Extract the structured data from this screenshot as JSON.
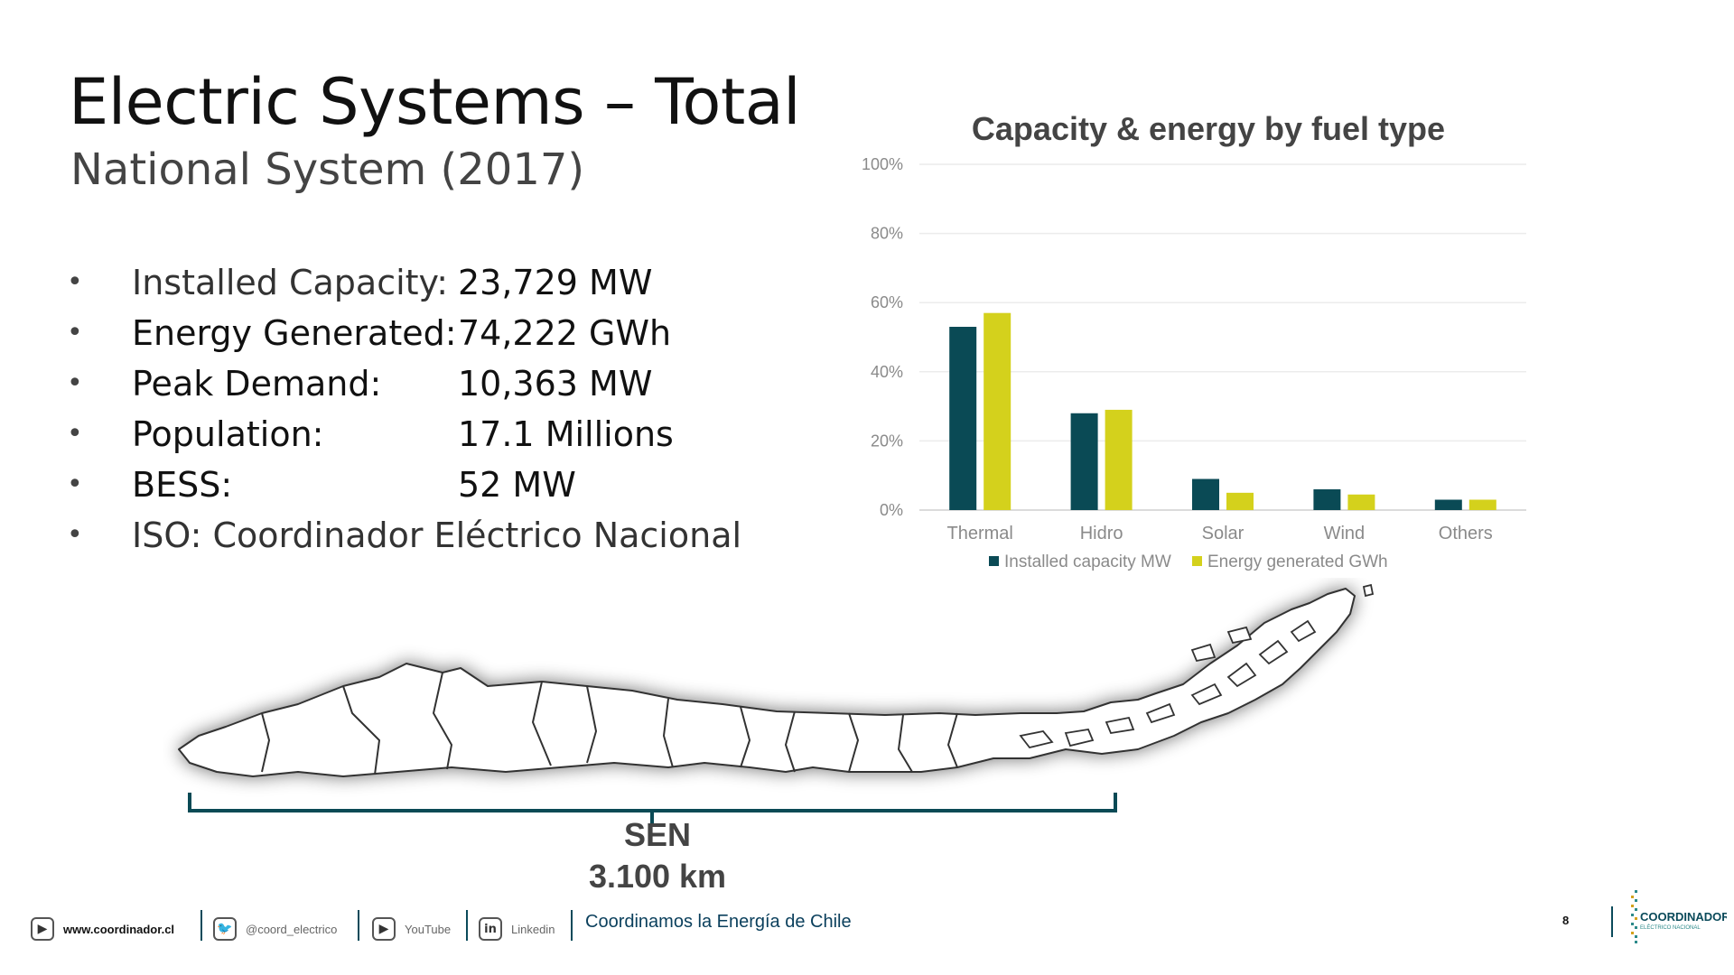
{
  "header": {
    "title": "Electric Systems – Total",
    "subtitle": "National System (2017)"
  },
  "bullets": [
    {
      "label": "Installed Capacity:",
      "value": "23,729 MW"
    },
    {
      "label": "Energy Generated:",
      "value": "74,222 GWh"
    },
    {
      "label": "Peak Demand:",
      "value": "10,363 MW"
    },
    {
      "label": "Population:",
      "value": "17.1 Millions"
    },
    {
      "label": "BESS:",
      "value": "52 MW"
    },
    {
      "label": "ISO: Coordinador Eléctrico Nacional",
      "value": ""
    }
  ],
  "chart_data": {
    "type": "bar",
    "title": "Capacity & energy by fuel type",
    "categories": [
      "Thermal",
      "Hidro",
      "Solar",
      "Wind",
      "Others"
    ],
    "series": [
      {
        "name": "Installed capacity MW",
        "color": "#0a4a55",
        "values": [
          53,
          28,
          9,
          6,
          3
        ]
      },
      {
        "name": "Energy generated GWh",
        "color": "#d4d11c",
        "values": [
          57,
          29,
          5,
          4.5,
          3
        ]
      }
    ],
    "ylim": [
      0,
      100
    ],
    "yticks": [
      "0%",
      "20%",
      "40%",
      "60%",
      "80%",
      "100%"
    ],
    "ytick_values": [
      0,
      20,
      40,
      60,
      80,
      100
    ],
    "grid": true,
    "legend": "bottom"
  },
  "map": {
    "scale_name": "SEN",
    "scale_distance": "3.100 km"
  },
  "footer": {
    "website": "www.coordinador.cl",
    "twitter": "@coord_electrico",
    "youtube": "YouTube",
    "linkedin": "Linkedin",
    "slogan": "Coordinamos la Energía de Chile",
    "page_number": "8",
    "logo_text": "COORDINADOR",
    "logo_subtext": "ELÉCTRICO NACIONAL"
  },
  "colors": {
    "accent": "#0a4a55",
    "secondary": "#d4d11c",
    "slogan": "#0a3f5c"
  }
}
